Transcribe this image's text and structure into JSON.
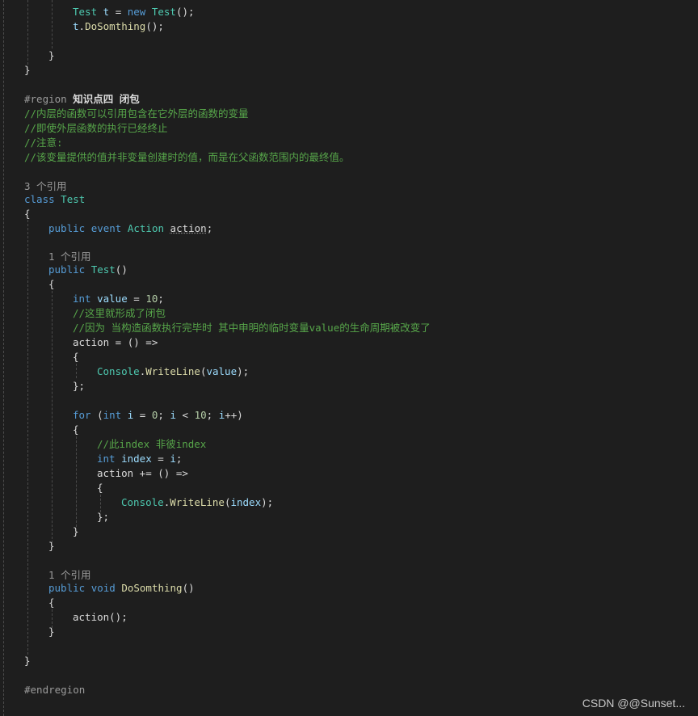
{
  "code": {
    "l_test_decl": {
      "type": "Test",
      "var": "t",
      "op": " = ",
      "kw_new": "new",
      "ctor": "Test",
      "tail": "();"
    },
    "l_call": {
      "var": "t",
      "dot": ".",
      "method": "DoSomthing",
      "tail": "();"
    },
    "l_close_inner": "}",
    "l_close_outer": "}",
    "region": {
      "directive": "#region",
      "name": "知识点四 闭包"
    },
    "comments": [
      "//内层的函数可以引用包含在它外层的函数的变量",
      "//即使外层函数的执行已经终止",
      "//注意:",
      "//该变量提供的值并非变量创建时的值，而是在父函数范围内的最终值。"
    ],
    "lens_class": "3 个引用",
    "class_decl": {
      "kw": "class",
      "name": "Test"
    },
    "brace_open": "{",
    "brace_close": "}",
    "event_decl": {
      "kw_public": "public",
      "kw_event": "event",
      "type": "Action",
      "name": "action",
      "tail": ";"
    },
    "lens_ctor": "1 个引用",
    "ctor_decl": {
      "kw": "public",
      "name": "Test",
      "tail": "()"
    },
    "int_value": {
      "kw": "int",
      "name": "value",
      "op": " = ",
      "num": "10",
      "tail": ";"
    },
    "comment_closure": "//这里就形成了闭包",
    "comment_because": "//因为 当构造函数执行完毕时 其中申明的临时变量value的生命周期被改变了",
    "assign1": {
      "name": "action",
      "rest": " = () =>"
    },
    "console1": {
      "cls": "Console",
      "dot": ".",
      "method": "WriteLine",
      "open": "(",
      "arg": "value",
      "close": ");"
    },
    "lambda_close": "};",
    "for_line": {
      "kw": "for",
      "p1": " (",
      "kw_int": "int",
      "var": "i",
      "op1": " = ",
      "n0": "0",
      "sep1": "; ",
      "var2": "i",
      "op2": " < ",
      "n10": "10",
      "sep2": "; ",
      "var3": "i",
      "tail": "++)"
    },
    "comment_index": "//此index 非彼index",
    "int_index": {
      "kw": "int",
      "name": "index",
      "op": " = ",
      "var": "i",
      "tail": ";"
    },
    "assign2": {
      "name": "action",
      "rest": " += () =>"
    },
    "console2": {
      "cls": "Console",
      "dot": ".",
      "method": "WriteLine",
      "open": "(",
      "arg": "index",
      "close": ");"
    },
    "lens_method": "1 个引用",
    "method_decl": {
      "kw_public": "public",
      "kw_void": "void",
      "name": "DoSomthing",
      "tail": "()"
    },
    "action_call": "action();",
    "endregion": "#endregion"
  },
  "watermark": "CSDN @@Sunset..."
}
